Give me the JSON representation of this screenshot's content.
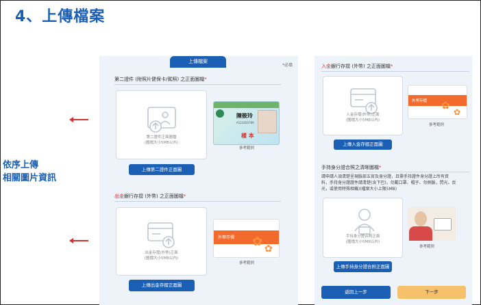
{
  "title": "4、上傳檔案",
  "side_note": [
    "依序上傳",
    "相關圖片資訊"
  ],
  "form": {
    "tab_label": "上傳檔案",
    "required_note": "*必填",
    "left": {
      "sec1_label": "第二證件 (附照片健保卡/駕照) 之正面圖檔",
      "sec1_box_hint": [
        "第二證件正面圖檔",
        "(圖檔大小5MB以內)"
      ],
      "sec1_button": "上傳第二證件正面圖",
      "sec1_ref": "參考範例",
      "sec1_card_name": "陳筱玲",
      "sec1_card_stamp": "樣 本",
      "sec1_card_no": "A123456789",
      "sec2_label_hl": "出金",
      "sec2_label_rest": "銀行存摺 (外幣) 之正面圖檔",
      "sec2_box_hint": [
        "出金存摺(外幣)正面",
        "(圖檔大小5MB以內)"
      ],
      "sec2_button": "上傳出金存摺正面圖",
      "sec2_ref": "參考範例",
      "sec2_card_title": "外幣存摺"
    },
    "right": {
      "sec1_label_hl": "入金",
      "sec1_label_rest": "銀行存摺 (外幣) 之正面圖檔",
      "sec1_box_hint": [
        "入金存摺(外幣)正面",
        "(圖檔大小5MB以內)"
      ],
      "sec1_button": "上傳入金存摺正面圖",
      "sec1_ref": "參考範例",
      "sec1_card_title": "外幣存摺",
      "sec2_label": "手持身分證合照之清晰圖檔",
      "sec2_desc": [
        "請申請人須清楚呈現臉部五官及身分證，且需手持證件身分證上所有資",
        "料，手持身分證證件請清楚(含下巴)，勿戴口罩、帽子、勿側臉，閃光、反",
        "光，或使用特殊相機)(檔案大小上限5MB)"
      ],
      "sec2_box_hint": [
        "手持身分證合照正面",
        "(圖檔大小5MB以內)"
      ],
      "sec2_button": "上傳手持身分證合照正面圖",
      "sec2_ref": "參考範例",
      "back_button": "返回上一步",
      "next_button": "下一步"
    }
  },
  "colors": {
    "accent": "#1a5fb4",
    "arrow": "#d32f2f",
    "bank_orange": "#f26b2c",
    "next_button": "#f5c26b"
  }
}
